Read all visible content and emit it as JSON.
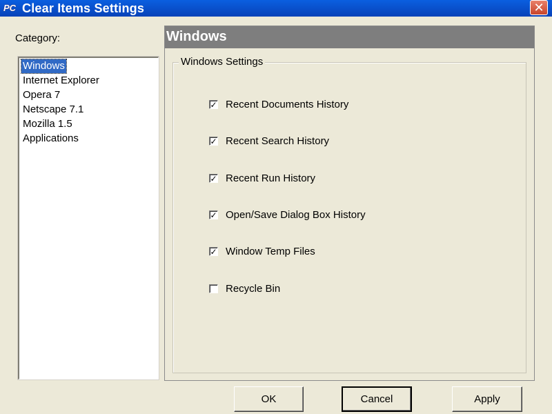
{
  "window": {
    "title": "Clear Items Settings",
    "app_icon_text": "PC",
    "close_glyph": "✕"
  },
  "category": {
    "label": "Category:",
    "items": [
      {
        "label": "Windows",
        "selected": true
      },
      {
        "label": "Internet Explorer",
        "selected": false
      },
      {
        "label": "Opera 7",
        "selected": false
      },
      {
        "label": "Netscape 7.1",
        "selected": false
      },
      {
        "label": "Mozilla 1.5",
        "selected": false
      },
      {
        "label": "Applications",
        "selected": false
      }
    ]
  },
  "panel": {
    "header": "Windows",
    "group_title": "Windows Settings",
    "options": [
      {
        "label": "Recent Documents History",
        "checked": true
      },
      {
        "label": "Recent Search History",
        "checked": true
      },
      {
        "label": "Recent Run History",
        "checked": true
      },
      {
        "label": "Open/Save Dialog Box History",
        "checked": true
      },
      {
        "label": "Window Temp Files",
        "checked": true
      },
      {
        "label": "Recycle Bin",
        "checked": false
      }
    ]
  },
  "buttons": {
    "ok": "OK",
    "cancel": "Cancel",
    "apply": "Apply"
  },
  "colors": {
    "titlebar": "#0a5fe0",
    "selection": "#316ac5",
    "panel_header": "#7e7e7e",
    "dialog_bg": "#ece9d8"
  }
}
